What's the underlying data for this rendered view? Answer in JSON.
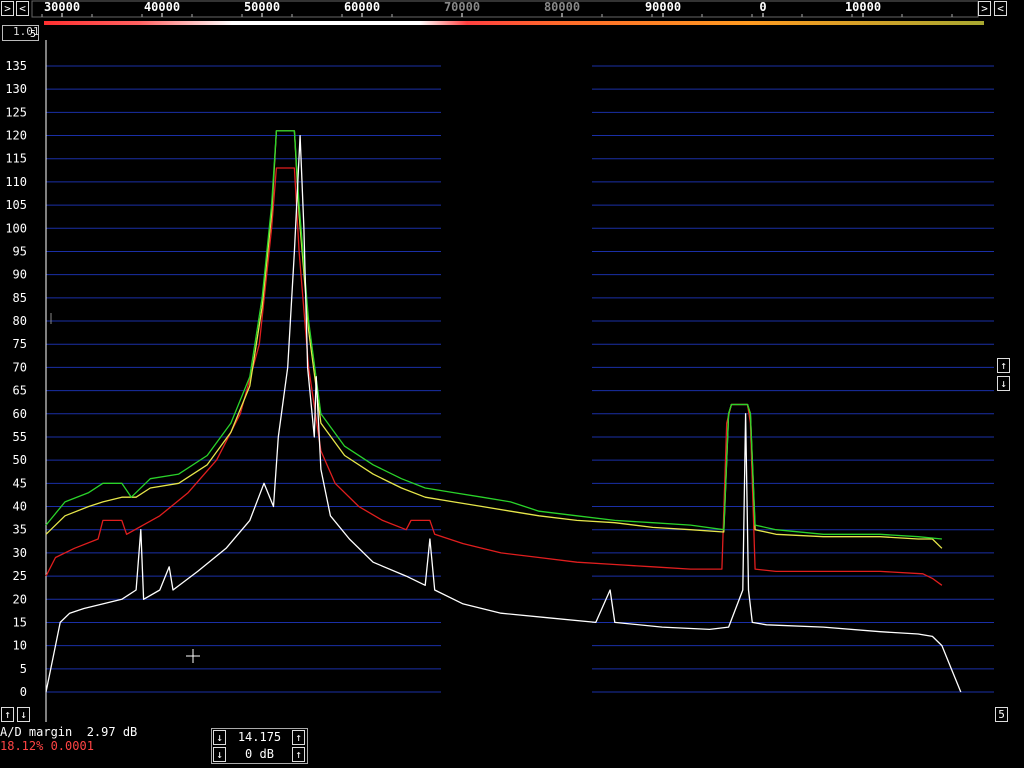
{
  "freq_axis": {
    "segments": [
      {
        "labels": [
          "30000",
          "40000",
          "50000",
          "60000",
          "70000",
          "80000"
        ],
        "start": 30000,
        "end": 97500
      },
      {
        "labels": [
          "90000",
          "0",
          "10000"
        ],
        "start": 85000,
        "end": 20000
      }
    ]
  },
  "top_controls": {
    "left_arrow_1": ">",
    "left_arrow_2": "<",
    "right_arrow_1": ">",
    "right_arrow_2": "<",
    "zoom_value": "1.01"
  },
  "side_controls": {
    "up_arrow": "↑",
    "down_arrow": "↓",
    "corner_number": "5"
  },
  "status": {
    "ad_margin_label": "A/D margin",
    "ad_margin_value": "2.97 dB",
    "load_text": "18.12% 0.0001"
  },
  "panel": {
    "gain_value": "14.175",
    "db_value": "0 dB",
    "up": "↑",
    "down": "↓"
  },
  "colors": {
    "grid": "#1a2fa6",
    "white": "#ffffff",
    "green": "#2ad22a",
    "yellow": "#e6e64a",
    "red": "#e01e1e",
    "status_red": "#ff4444"
  },
  "chart_data": {
    "type": "line",
    "xlabel": "",
    "ylabel": "",
    "ylim": [
      0,
      135
    ],
    "ytick_labels": [
      "0",
      "5",
      "10",
      "15",
      "20",
      "25",
      "30",
      "35",
      "40",
      "45",
      "50",
      "55",
      "60",
      "65",
      "70",
      "75",
      "80",
      "85",
      "90",
      "95",
      "100",
      "105",
      "110",
      "115",
      "120",
      "125",
      "130",
      "135"
    ],
    "x_units": "bin",
    "xlim": [
      0,
      1000
    ],
    "series": [
      {
        "color": "white",
        "points": [
          [
            0,
            0
          ],
          [
            8,
            8
          ],
          [
            15,
            15
          ],
          [
            25,
            17
          ],
          [
            40,
            18
          ],
          [
            60,
            19
          ],
          [
            80,
            20
          ],
          [
            95,
            22
          ],
          [
            100,
            35
          ],
          [
            103,
            20
          ],
          [
            120,
            22
          ],
          [
            130,
            27
          ],
          [
            134,
            22
          ],
          [
            160,
            26
          ],
          [
            190,
            31
          ],
          [
            215,
            37
          ],
          [
            230,
            45
          ],
          [
            240,
            40
          ],
          [
            245,
            55
          ],
          [
            255,
            70
          ],
          [
            262,
            95
          ],
          [
            268,
            120
          ],
          [
            272,
            100
          ],
          [
            276,
            70
          ],
          [
            283,
            55
          ],
          [
            285,
            68
          ],
          [
            290,
            48
          ],
          [
            300,
            38
          ],
          [
            320,
            33
          ],
          [
            345,
            28
          ],
          [
            380,
            25
          ],
          [
            400,
            23
          ],
          [
            405,
            33
          ],
          [
            410,
            22
          ],
          [
            440,
            19
          ],
          [
            480,
            17
          ],
          [
            530,
            16
          ],
          [
            580,
            15
          ],
          [
            595,
            22
          ],
          [
            600,
            15
          ],
          [
            650,
            14
          ],
          [
            700,
            13.5
          ],
          [
            720,
            14
          ],
          [
            735,
            22
          ],
          [
            738,
            60
          ],
          [
            741,
            22
          ],
          [
            745,
            15
          ],
          [
            760,
            14.5
          ],
          [
            820,
            14
          ],
          [
            880,
            13
          ],
          [
            920,
            12.5
          ],
          [
            935,
            12
          ],
          [
            945,
            10
          ],
          [
            955,
            5
          ],
          [
            965,
            0
          ]
        ]
      },
      {
        "color": "green",
        "points": [
          [
            0,
            36
          ],
          [
            20,
            41
          ],
          [
            45,
            43
          ],
          [
            60,
            45
          ],
          [
            80,
            45
          ],
          [
            90,
            42
          ],
          [
            110,
            46
          ],
          [
            140,
            47
          ],
          [
            170,
            51
          ],
          [
            195,
            58
          ],
          [
            215,
            68
          ],
          [
            228,
            85
          ],
          [
            238,
            105
          ],
          [
            243,
            121
          ],
          [
            262,
            121
          ],
          [
            267,
            105
          ],
          [
            277,
            80
          ],
          [
            290,
            60
          ],
          [
            315,
            53
          ],
          [
            345,
            49
          ],
          [
            375,
            46
          ],
          [
            400,
            44
          ],
          [
            430,
            43
          ],
          [
            460,
            42
          ],
          [
            490,
            41
          ],
          [
            520,
            39
          ],
          [
            560,
            38
          ],
          [
            600,
            37
          ],
          [
            640,
            36.5
          ],
          [
            680,
            36
          ],
          [
            715,
            35
          ],
          [
            720,
            60
          ],
          [
            723,
            62
          ],
          [
            740,
            62
          ],
          [
            743,
            60
          ],
          [
            748,
            36
          ],
          [
            770,
            35
          ],
          [
            820,
            34
          ],
          [
            880,
            34
          ],
          [
            920,
            33.5
          ],
          [
            945,
            33
          ]
        ]
      },
      {
        "color": "yellow",
        "points": [
          [
            0,
            34
          ],
          [
            20,
            38
          ],
          [
            45,
            40
          ],
          [
            60,
            41
          ],
          [
            80,
            42
          ],
          [
            95,
            42
          ],
          [
            110,
            44
          ],
          [
            140,
            45
          ],
          [
            170,
            49
          ],
          [
            195,
            56
          ],
          [
            215,
            66
          ],
          [
            228,
            83
          ],
          [
            238,
            103
          ],
          [
            243,
            121
          ],
          [
            262,
            121
          ],
          [
            267,
            103
          ],
          [
            277,
            78
          ],
          [
            290,
            58
          ],
          [
            315,
            51
          ],
          [
            345,
            47
          ],
          [
            375,
            44
          ],
          [
            400,
            42
          ],
          [
            430,
            41
          ],
          [
            460,
            40
          ],
          [
            490,
            39
          ],
          [
            520,
            38
          ],
          [
            560,
            37
          ],
          [
            600,
            36.5
          ],
          [
            640,
            35.5
          ],
          [
            680,
            35
          ],
          [
            715,
            34.5
          ],
          [
            720,
            60
          ],
          [
            723,
            62
          ],
          [
            740,
            62
          ],
          [
            743,
            60
          ],
          [
            748,
            35
          ],
          [
            770,
            34
          ],
          [
            820,
            33.5
          ],
          [
            880,
            33.5
          ],
          [
            920,
            33
          ],
          [
            935,
            33
          ],
          [
            945,
            31
          ]
        ]
      },
      {
        "color": "red",
        "points": [
          [
            0,
            25
          ],
          [
            10,
            29
          ],
          [
            30,
            31
          ],
          [
            55,
            33
          ],
          [
            60,
            37
          ],
          [
            80,
            37
          ],
          [
            85,
            34
          ],
          [
            120,
            38
          ],
          [
            150,
            43
          ],
          [
            180,
            50
          ],
          [
            205,
            60
          ],
          [
            225,
            75
          ],
          [
            238,
            100
          ],
          [
            243,
            113
          ],
          [
            262,
            113
          ],
          [
            267,
            95
          ],
          [
            277,
            70
          ],
          [
            290,
            52
          ],
          [
            305,
            45
          ],
          [
            330,
            40
          ],
          [
            355,
            37
          ],
          [
            380,
            35
          ],
          [
            385,
            37
          ],
          [
            405,
            37
          ],
          [
            410,
            34
          ],
          [
            440,
            32
          ],
          [
            480,
            30
          ],
          [
            520,
            29
          ],
          [
            560,
            28
          ],
          [
            600,
            27.5
          ],
          [
            640,
            27
          ],
          [
            680,
            26.5
          ],
          [
            713,
            26.5
          ],
          [
            718,
            58
          ],
          [
            723,
            62
          ],
          [
            740,
            62
          ],
          [
            743,
            58
          ],
          [
            748,
            26.5
          ],
          [
            770,
            26
          ],
          [
            820,
            26
          ],
          [
            880,
            26
          ],
          [
            925,
            25.5
          ],
          [
            935,
            24.5
          ],
          [
            945,
            23
          ]
        ]
      }
    ]
  }
}
